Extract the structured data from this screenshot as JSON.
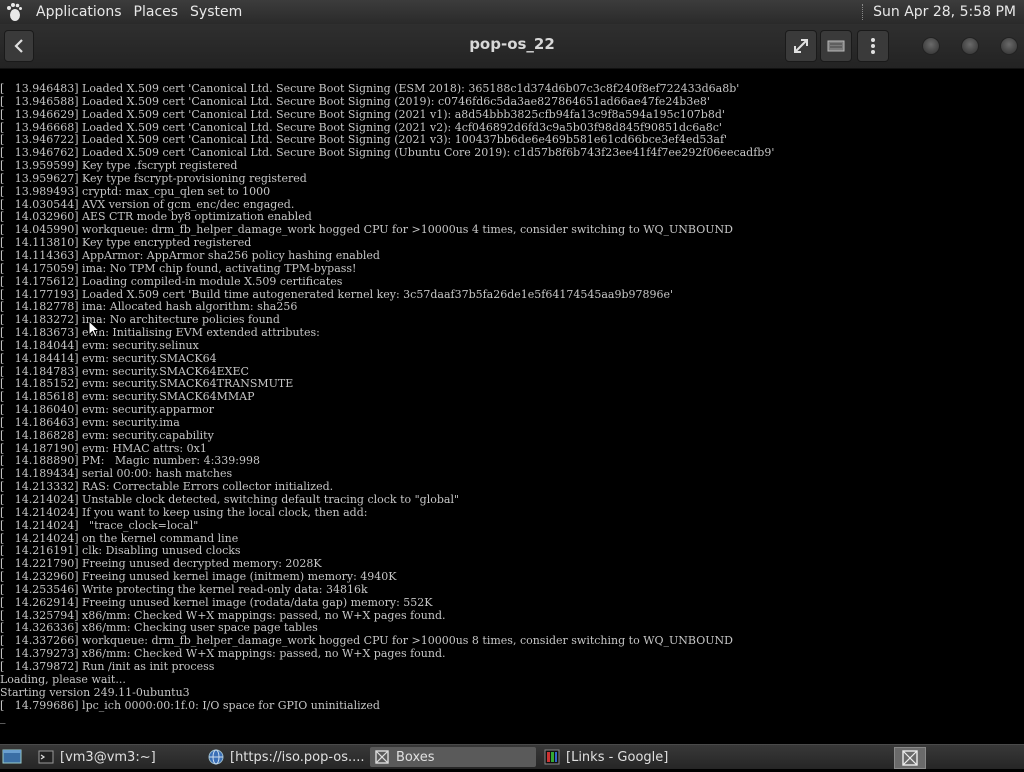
{
  "top_panel": {
    "menus": [
      "Applications",
      "Places",
      "System"
    ],
    "clock": "Sun Apr 28,  5:58 PM"
  },
  "header": {
    "title": "pop-os_22"
  },
  "console": {
    "lines": [
      "[   13.946483] Loaded X.509 cert 'Canonical Ltd. Secure Boot Signing (ESM 2018): 365188c1d374d6b07c3c8f240f8ef722433d6a8b'",
      "[   13.946588] Loaded X.509 cert 'Canonical Ltd. Secure Boot Signing (2019): c0746fd6c5da3ae827864651ad66ae47fe24b3e8'",
      "[   13.946629] Loaded X.509 cert 'Canonical Ltd. Secure Boot Signing (2021 v1): a8d54bbb3825cfb94fa13c9f8a594a195c107b8d'",
      "[   13.946668] Loaded X.509 cert 'Canonical Ltd. Secure Boot Signing (2021 v2): 4cf046892d6fd3c9a5b03f98d845f90851dc6a8c'",
      "[   13.946722] Loaded X.509 cert 'Canonical Ltd. Secure Boot Signing (2021 v3): 100437bb6de6e469b581e61cd66bce3ef4ed53af'",
      "[   13.946762] Loaded X.509 cert 'Canonical Ltd. Secure Boot Signing (Ubuntu Core 2019): c1d57b8f6b743f23ee41f4f7ee292f06eecadfb9'",
      "[   13.959599] Key type .fscrypt registered",
      "[   13.959627] Key type fscrypt-provisioning registered",
      "[   13.989493] cryptd: max_cpu_qlen set to 1000",
      "[   14.030544] AVX version of gcm_enc/dec engaged.",
      "[   14.032960] AES CTR mode by8 optimization enabled",
      "[   14.045990] workqueue: drm_fb_helper_damage_work hogged CPU for >10000us 4 times, consider switching to WQ_UNBOUND",
      "[   14.113810] Key type encrypted registered",
      "[   14.114363] AppArmor: AppArmor sha256 policy hashing enabled",
      "[   14.175059] ima: No TPM chip found, activating TPM-bypass!",
      "[   14.175612] Loading compiled-in module X.509 certificates",
      "[   14.177193] Loaded X.509 cert 'Build time autogenerated kernel key: 3c57daaf37b5fa26de1e5f64174545aa9b97896e'",
      "[   14.182778] ima: Allocated hash algorithm: sha256",
      "[   14.183272] ima: No architecture policies found",
      "[   14.183673] evm: Initialising EVM extended attributes:",
      "[   14.184044] evm: security.selinux",
      "[   14.184414] evm: security.SMACK64",
      "[   14.184783] evm: security.SMACK64EXEC",
      "[   14.185152] evm: security.SMACK64TRANSMUTE",
      "[   14.185618] evm: security.SMACK64MMAP",
      "[   14.186040] evm: security.apparmor",
      "[   14.186463] evm: security.ima",
      "[   14.186828] evm: security.capability",
      "[   14.187190] evm: HMAC attrs: 0x1",
      "[   14.188890] PM:   Magic number: 4:339:998",
      "[   14.189434] serial 00:00: hash matches",
      "[   14.213332] RAS: Correctable Errors collector initialized.",
      "[   14.214024] Unstable clock detected, switching default tracing clock to \"global\"",
      "[   14.214024] If you want to keep using the local clock, then add:",
      "[   14.214024]   \"trace_clock=local\"",
      "[   14.214024] on the kernel command line",
      "[   14.216191] clk: Disabling unused clocks",
      "[   14.221790] Freeing unused decrypted memory: 2028K",
      "[   14.232960] Freeing unused kernel image (initmem) memory: 4940K",
      "[   14.253546] Write protecting the kernel read-only data: 34816k",
      "[   14.262914] Freeing unused kernel image (rodata/data gap) memory: 552K",
      "[   14.325794] x86/mm: Checked W+X mappings: passed, no W+X pages found.",
      "[   14.326336] x86/mm: Checking user space page tables",
      "[   14.337266] workqueue: drm_fb_helper_damage_work hogged CPU for >10000us 8 times, consider switching to WQ_UNBOUND",
      "[   14.379273] x86/mm: Checked W+X mappings: passed, no W+X pages found.",
      "[   14.379872] Run /init as init process",
      "Loading, please wait...",
      "Starting version 249.11-0ubuntu3",
      "[   14.799686] lpc_ich 0000:00:1f.0: I/O space for GPIO uninitialized"
    ],
    "cursor": "_"
  },
  "taskbar": {
    "tasks": [
      {
        "label": "[vm3@vm3:~]",
        "icon": "terminal-icon"
      },
      {
        "label": "[https://iso.pop-os....",
        "icon": "browser-icon"
      },
      {
        "label": "Boxes",
        "icon": "boxes-icon"
      },
      {
        "label": "[Links - Google]",
        "icon": "links-icon"
      }
    ]
  },
  "colors": {
    "panel_bg": "#2e2e2e",
    "console_text": "#c6c6c6",
    "console_bg": "#000000",
    "active_task": "#5a5a5a"
  }
}
